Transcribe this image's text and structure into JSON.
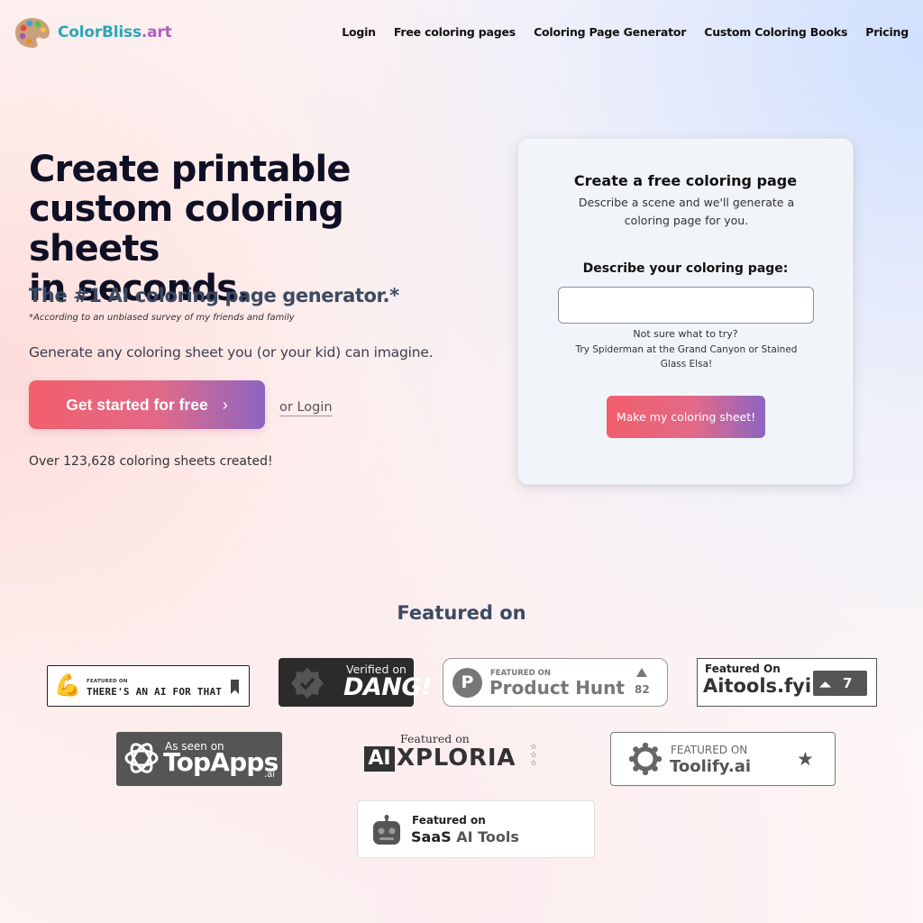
{
  "nav": {
    "brand_part1": "ColorBliss",
    "brand_part2": ".art",
    "links": [
      "Login",
      "Free coloring pages",
      "Coloring Page Generator",
      "Custom Coloring Books",
      "Pricing"
    ]
  },
  "hero": {
    "title_line1": "Create printable",
    "title_line2": "custom coloring sheets",
    "title_line3": "in seconds.",
    "subtitle": "The #1 AI coloring page generator.*",
    "disclaimer": "*According to an unbiased survey of my friends and family",
    "tagline": "Generate any coloring sheet you (or your kid) can imagine.",
    "cta_label": "Get started for free",
    "cta_icon": "chevron-right-icon",
    "login_link": "or Login",
    "sheet_count": "Over 123,628 coloring sheets created!"
  },
  "card": {
    "title": "Create a free coloring page",
    "description": "Describe a scene and we'll generate a coloring page for you.",
    "input_label": "Describe your coloring page:",
    "input_value": "",
    "hint_question": "Not sure what to try?",
    "hint_examples": "Try Spiderman at the Grand Canyon or Stained Glass Elsa!",
    "submit_label": "Make my coloring sheet!"
  },
  "featured": {
    "title": "Featured on",
    "aiforthat": {
      "small": "FEATURED ON",
      "big": "THERE'S AN AI FOR THAT"
    },
    "dang": {
      "top": "Verified on",
      "name": "DANG!"
    },
    "producthunt": {
      "small": "FEATURED ON",
      "name": "Product Hunt",
      "votes": "82"
    },
    "aitools": {
      "label": "Featured On",
      "name": "Aitools.fyi",
      "score": "7"
    },
    "topapps": {
      "label": "As seen on",
      "name": "TopApps",
      "suffix": ".ai"
    },
    "aixploria": {
      "label": "Featured on",
      "ai": "AI",
      "name": "XPLORIA"
    },
    "toolify": {
      "label": "FEATURED ON",
      "name": "Toolify.ai"
    },
    "saas": {
      "label": "Featured on",
      "name1": "SaaS",
      "name2": "AI Tools"
    }
  },
  "colors": {
    "brand_teal": "#2aa7b8",
    "brand_purple": "#b05fbf",
    "cta_gradient_start": "#f25e6c",
    "cta_gradient_end": "#8c65c2",
    "card_bg": "#f1f4f9"
  }
}
